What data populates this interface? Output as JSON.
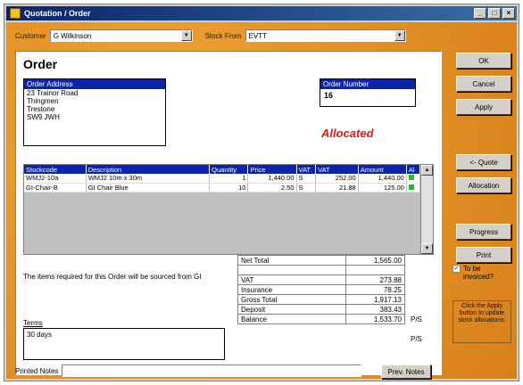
{
  "window": {
    "title": "Quotation / Order",
    "controls": [
      "_",
      "□",
      "×"
    ]
  },
  "toolbar": {
    "customer_label": "Customer",
    "customer_value": "G Wilkinson",
    "stock_from_label": "Stock From",
    "stock_from_value": "EVTT"
  },
  "order": {
    "heading": "Order",
    "address_header": "Order Address",
    "address_lines": [
      "23 Trainor Road",
      "Thingmen",
      "Trestone",
      "SW9 JWH"
    ],
    "number_header": "Order Number",
    "number_value": "16",
    "status": "Allocated"
  },
  "lines_table": {
    "headers": [
      "Stockcode",
      "Description",
      "Quantity",
      "Price",
      "VAT",
      "VAT",
      "Amount",
      "Al"
    ],
    "rows": [
      [
        "WMJ2-10a",
        "WMJ2 10m x 30m",
        "1",
        "1,440.00",
        "S",
        "252.00",
        "1,440.00",
        "alloc"
      ],
      [
        "GI-Chair-B",
        "GI Chair Blue",
        "10",
        "2.50",
        "S",
        "21.88",
        "125.00",
        "alloc"
      ]
    ]
  },
  "notes": {
    "source_note": "The items required for this Order will be sourced from GI",
    "terms_label": "Terms",
    "terms_value": "30 days"
  },
  "totals": {
    "rows": [
      {
        "label": "Net Total",
        "value": "1,565.00"
      },
      {
        "label": "",
        "value": ""
      },
      {
        "label": "VAT",
        "value": "273.88"
      },
      {
        "label": "Insurance",
        "value": "78.25"
      },
      {
        "label": "Gross Total",
        "value": "1,917.13"
      },
      {
        "label": "Deposit",
        "value": "383.43"
      },
      {
        "label": "Balance",
        "value": "1,533.70"
      }
    ],
    "pf1": "P/S",
    "pf2": "P/S"
  },
  "side_buttons": {
    "ok": "OK",
    "cancel": "Cancel",
    "apply": "Apply",
    "quote": "<- Quote",
    "allocation": "Allocation",
    "progress": "Progress",
    "print": "Print"
  },
  "to_be_invoiced": {
    "checked": "✓",
    "label": "To be invoiced?"
  },
  "hint": "Click the Apply button to update stock allocations.",
  "footer": {
    "printed_label": "Printed Notes",
    "printed_value": "",
    "prev_notes": "Prev. Notes"
  },
  "colors": {
    "background": "#e8962a",
    "header": "#0a24b0",
    "status": "#e01818",
    "titlebar": "#0a246a"
  }
}
